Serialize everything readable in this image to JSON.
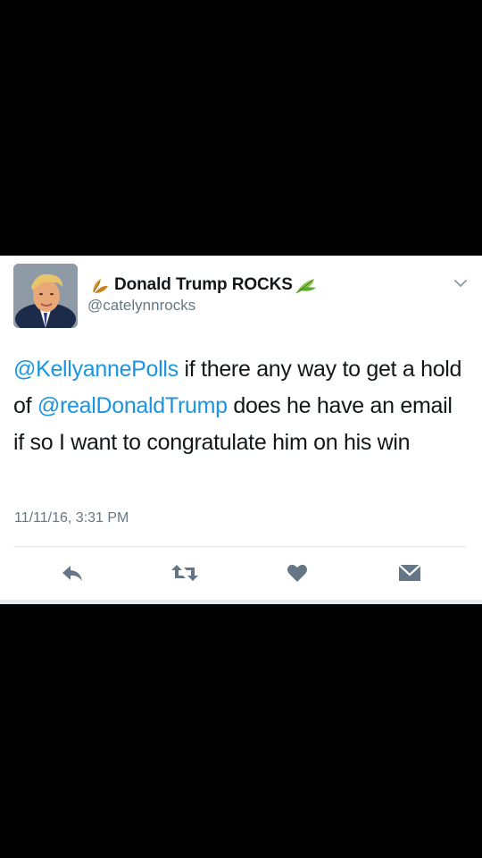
{
  "tweet": {
    "display_name": "Donald Trump ROCKS",
    "handle": "@catelynnrocks",
    "text_parts": {
      "mention1": "@KellyannePolls",
      "text1": " if there any way to get a hold of ",
      "mention2": "@realDonaldTrump",
      "text2": " does he have an email if so I want to congratulate him on his win"
    },
    "timestamp": "11/11/16, 3:31 PM"
  },
  "icons": {
    "before_name": "fallen-leaf-emoji",
    "after_name": "herb-leaf-emoji",
    "menu": "chevron-down-icon",
    "reply": "reply-icon",
    "retweet": "retweet-icon",
    "like": "heart-icon",
    "dm": "envelope-icon"
  },
  "colors": {
    "mention": "#1b95e0",
    "text": "#14171a",
    "secondary": "#657786",
    "icon": "#657786"
  }
}
